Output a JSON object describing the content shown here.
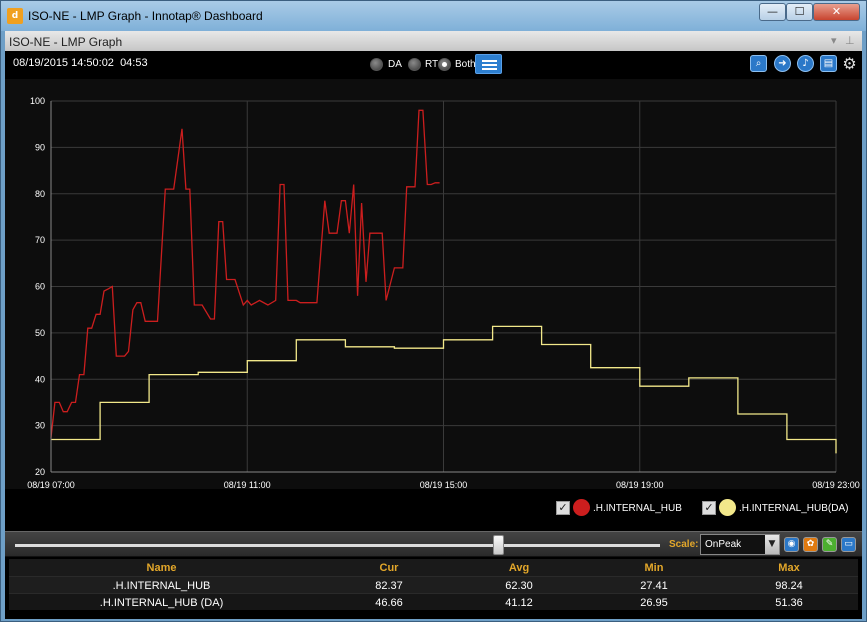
{
  "window": {
    "title": "ISO-NE - LMP Graph - Innotap® Dashboard",
    "icon_text": "d",
    "controls": {
      "minimize": "—",
      "maximize": "☐",
      "close": "✕"
    }
  },
  "panel": {
    "title": "ISO-NE - LMP Graph",
    "pin_icon": "⊥",
    "dropdown_icon": "▾"
  },
  "toolbar": {
    "datetime": "08/19/2015 14:50:02",
    "time_extra": "04:53",
    "modes": [
      {
        "label": "DA",
        "selected": false
      },
      {
        "label": "RT",
        "selected": false
      },
      {
        "label": "Both",
        "selected": true
      }
    ],
    "icons": [
      "zoom-icon",
      "forward-icon",
      "sound-icon",
      "export-icon",
      "settings-icon"
    ]
  },
  "chart_data": {
    "type": "line",
    "x_tick_labels": [
      "08/19 07:00",
      "08/19 11:00",
      "08/19 15:00",
      "08/19 19:00",
      "08/19 23:00"
    ],
    "y_ticks": [
      20,
      30,
      40,
      50,
      60,
      70,
      80,
      90,
      100
    ],
    "xlim_hours": [
      7,
      23
    ],
    "ylim": [
      20,
      100
    ],
    "grid": true,
    "colors": {
      "rt": "#cc1e1e",
      "da": "#f2e88a"
    },
    "series": [
      {
        "name": ".H.INTERNAL_HUB",
        "color": "#cc1e1e",
        "x": [
          7.0,
          7.08,
          7.17,
          7.25,
          7.33,
          7.42,
          7.5,
          7.58,
          7.67,
          7.75,
          7.83,
          7.92,
          8.0,
          8.08,
          8.17,
          8.25,
          8.33,
          8.5,
          8.58,
          8.67,
          8.75,
          8.83,
          8.92,
          9.0,
          9.17,
          9.33,
          9.42,
          9.5,
          9.67,
          9.75,
          9.83,
          9.92,
          10.0,
          10.08,
          10.25,
          10.33,
          10.42,
          10.5,
          10.58,
          10.75,
          10.92,
          11.0,
          11.08,
          11.25,
          11.42,
          11.58,
          11.67,
          11.75,
          11.83,
          12.0,
          12.08,
          12.17,
          12.42,
          12.58,
          12.67,
          12.83,
          12.92,
          13.0,
          13.08,
          13.17,
          13.25,
          13.33,
          13.42,
          13.5,
          13.58,
          13.67,
          13.75,
          13.83,
          14.0,
          14.17,
          14.25,
          14.33,
          14.42,
          14.5,
          14.58,
          14.67,
          14.75,
          14.83,
          14.92
        ],
        "values": [
          27.4,
          35,
          35,
          33,
          33,
          35,
          35,
          41,
          41,
          51,
          51,
          54,
          54,
          59,
          59.5,
          60,
          45,
          45,
          46,
          55,
          56.5,
          56.5,
          52.5,
          52.5,
          52.5,
          81,
          81,
          81,
          94,
          81,
          81,
          56,
          56,
          56,
          53,
          53,
          74,
          74,
          61.5,
          61.5,
          56,
          57,
          56,
          57,
          56,
          57,
          82,
          82,
          57,
          57,
          56.5,
          56.5,
          56.5,
          78.5,
          71.5,
          71.5,
          78.5,
          78.5,
          71.5,
          82,
          58,
          78,
          61,
          71.5,
          71.5,
          71.5,
          71.5,
          57,
          64,
          64,
          81.5,
          81.5,
          81.5,
          98,
          98,
          82,
          82,
          82.37,
          82.37
        ]
      },
      {
        "name": ".H.INTERNAL_HUB(DA)",
        "color": "#f2e88a",
        "x": [
          7,
          8,
          9,
          10,
          11,
          12,
          13,
          14,
          15,
          16,
          17,
          18,
          19,
          20,
          21,
          22,
          23
        ],
        "values": [
          27,
          35,
          41,
          41.5,
          44,
          48.5,
          47,
          46.7,
          48.5,
          51.4,
          47.5,
          42.5,
          38.5,
          40.3,
          32.5,
          27,
          24
        ]
      }
    ]
  },
  "legend": [
    {
      "label": ".H.INTERNAL_HUB",
      "color": "#cc1e1e",
      "checked": true
    },
    {
      "label": ".H.INTERNAL_HUB(DA)",
      "color": "#f2e88a",
      "checked": true
    }
  ],
  "controls": {
    "slider_position": 0.75,
    "scale_label": "Scale:",
    "scale_value": "OnPeak",
    "buttons": [
      "view-icon",
      "palette-icon",
      "edit-icon",
      "layout-icon"
    ]
  },
  "stats": {
    "headers": [
      "Name",
      "Cur",
      "Avg",
      "Min",
      "Max"
    ],
    "rows": [
      [
        ".H.INTERNAL_HUB",
        "82.37",
        "62.30",
        "27.41",
        "98.24"
      ],
      [
        ".H.INTERNAL_HUB (DA)",
        "46.66",
        "41.12",
        "26.95",
        "51.36"
      ]
    ]
  }
}
